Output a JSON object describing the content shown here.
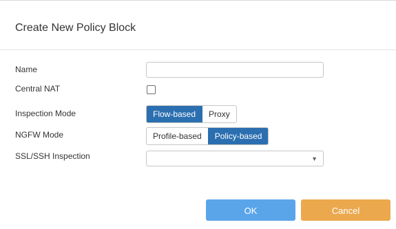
{
  "dialog": {
    "title": "Create New Policy Block"
  },
  "form": {
    "name": {
      "label": "Name",
      "value": "",
      "placeholder": ""
    },
    "central_nat": {
      "label": "Central NAT",
      "checked": false
    },
    "inspection_mode": {
      "label": "Inspection Mode",
      "options": [
        "Flow-based",
        "Proxy"
      ],
      "selected": "Flow-based"
    },
    "ngfw_mode": {
      "label": "NGFW Mode",
      "options": [
        "Profile-based",
        "Policy-based"
      ],
      "selected": "Policy-based"
    },
    "ssl_ssh_inspection": {
      "label": "SSL/SSH Inspection",
      "value": "",
      "caret_icon": "chevron-down-icon"
    }
  },
  "footer": {
    "ok_label": "OK",
    "cancel_label": "Cancel"
  },
  "colors": {
    "segment_active": "#2b6fb0",
    "ok_button": "#5aa5ea",
    "cancel_button": "#eba84d"
  }
}
